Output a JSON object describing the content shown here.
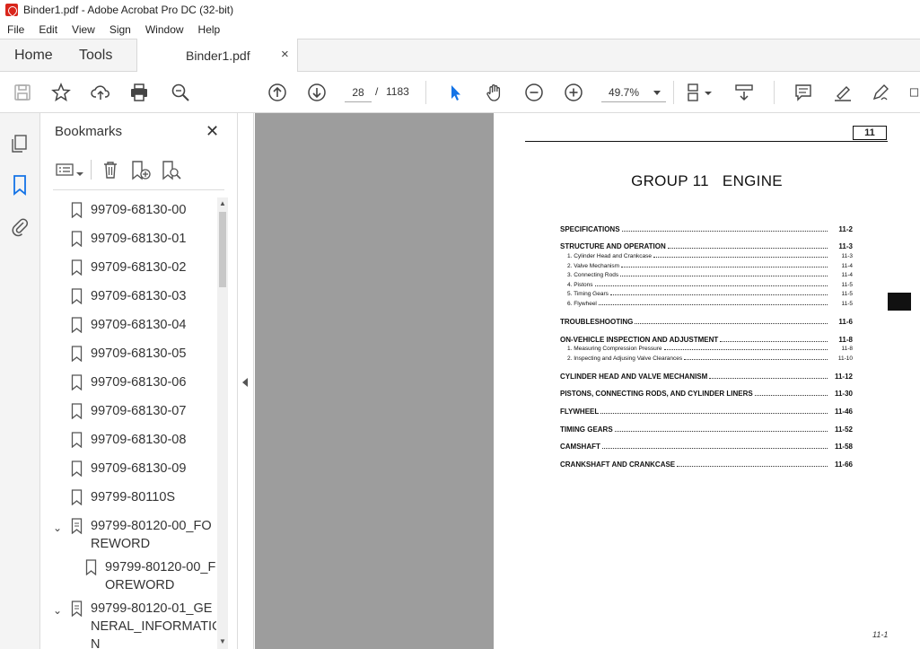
{
  "window": {
    "title": "Binder1.pdf - Adobe Acrobat Pro DC (32-bit)"
  },
  "menu": [
    "File",
    "Edit",
    "View",
    "Sign",
    "Window",
    "Help"
  ],
  "tabs": {
    "home": "Home",
    "tools": "Tools",
    "document": "Binder1.pdf",
    "close_glyph": "×"
  },
  "toolbar": {
    "current_page": "28",
    "page_separator": "/",
    "total_pages": "1183",
    "zoom": "49.7%"
  },
  "bookmarks": {
    "title": "Bookmarks",
    "items": [
      {
        "label": "99709-68130-00",
        "type": "bookmark"
      },
      {
        "label": "99709-68130-01",
        "type": "bookmark"
      },
      {
        "label": "99709-68130-02",
        "type": "bookmark"
      },
      {
        "label": "99709-68130-03",
        "type": "bookmark"
      },
      {
        "label": "99709-68130-04",
        "type": "bookmark"
      },
      {
        "label": "99709-68130-05",
        "type": "bookmark"
      },
      {
        "label": "99709-68130-06",
        "type": "bookmark"
      },
      {
        "label": "99709-68130-07",
        "type": "bookmark"
      },
      {
        "label": "99709-68130-08",
        "type": "bookmark"
      },
      {
        "label": "99709-68130-09",
        "type": "bookmark"
      },
      {
        "label": "99799-80110S",
        "type": "bookmark"
      },
      {
        "label_line1": "99799-80120-00_FO",
        "label_line2": "REWORD",
        "type": "group",
        "expanded": true
      },
      {
        "label_line1": "99799-80120-00_F",
        "label_line2": "OREWORD",
        "type": "bookmark-child"
      },
      {
        "label_line1": "99799-80120-01_GE",
        "label_line2": "NERAL_INFORMATIO",
        "label_line3": "N",
        "type": "group",
        "expanded": true
      }
    ]
  },
  "document": {
    "page_badge": "11",
    "title": "GROUP 11   ENGINE",
    "footer": "11-1",
    "toc": [
      {
        "text": "SPECIFICATIONS",
        "page": "11-2",
        "level": "main"
      },
      {
        "text": "STRUCTURE AND OPERATION",
        "page": "11-3",
        "level": "main"
      },
      {
        "text": "1.  Cylinder Head and Crankcase",
        "page": "11-3",
        "level": "sub"
      },
      {
        "text": "2.  Valve Mechanism",
        "page": "11-4",
        "level": "sub"
      },
      {
        "text": "3.  Connecting Rods",
        "page": "11-4",
        "level": "sub"
      },
      {
        "text": "4.  Pistons",
        "page": "11-5",
        "level": "sub"
      },
      {
        "text": "5.  Timing Gears",
        "page": "11-5",
        "level": "sub"
      },
      {
        "text": "6.  Flywheel",
        "page": "11-5",
        "level": "sub"
      },
      {
        "text": "TROUBLESHOOTING",
        "page": "11-6",
        "level": "main"
      },
      {
        "text": "ON-VEHICLE INSPECTION AND ADJUSTMENT",
        "page": "11-8",
        "level": "main"
      },
      {
        "text": "1.  Measuring Compression Pressure",
        "page": "11-8",
        "level": "sub"
      },
      {
        "text": "2.  Inspecting and Adjusing Valve Clearances",
        "page": "11-10",
        "level": "sub"
      },
      {
        "text": "CYLINDER HEAD AND VALVE MECHANISM",
        "page": "11-12",
        "level": "main"
      },
      {
        "text": "PISTONS, CONNECTING RODS, AND CYLINDER LINERS",
        "page": "11-30",
        "level": "main"
      },
      {
        "text": "FLYWHEEL",
        "page": "11-46",
        "level": "main"
      },
      {
        "text": "TIMING GEARS",
        "page": "11-52",
        "level": "main"
      },
      {
        "text": "CAMSHAFT",
        "page": "11-58",
        "level": "main"
      },
      {
        "text": "CRANKSHAFT AND CRANKCASE",
        "page": "11-66",
        "level": "main"
      }
    ]
  },
  "colors": {
    "accent": "#1473e6",
    "canvas": "#9d9d9d",
    "acrobat_red": "#d9261c"
  }
}
